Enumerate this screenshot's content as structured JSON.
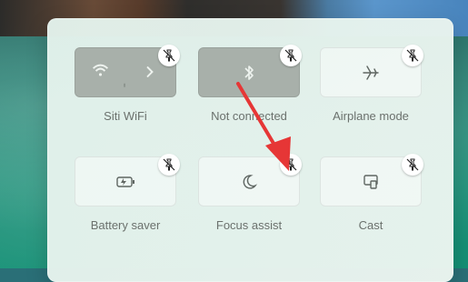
{
  "quick_settings": {
    "tiles": [
      {
        "label": "Siti WiFi",
        "state": "on",
        "icon": "wifi-icon",
        "has_chevron": true
      },
      {
        "label": "Not connected",
        "state": "on",
        "icon": "bluetooth-icon"
      },
      {
        "label": "Airplane mode",
        "state": "off",
        "icon": "airplane-icon"
      },
      {
        "label": "Battery saver",
        "state": "off",
        "icon": "battery-saver-icon"
      },
      {
        "label": "Focus assist",
        "state": "off",
        "icon": "moon-icon"
      },
      {
        "label": "Cast",
        "state": "off",
        "icon": "cast-icon"
      }
    ],
    "pin_icon": "unpin-icon"
  },
  "annotation": {
    "type": "arrow",
    "color": "#e63636"
  }
}
